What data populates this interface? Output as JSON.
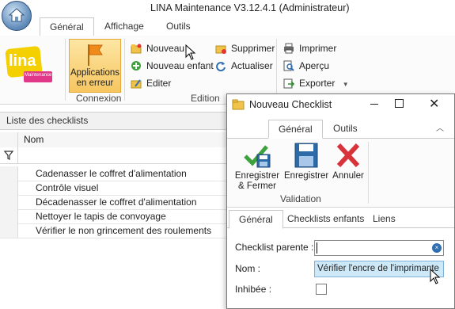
{
  "window": {
    "title": "LINA Maintenance  V3.12.4.1  (Administrateur)"
  },
  "ribbon_tabs": [
    "Général",
    "Affichage",
    "Outils"
  ],
  "logo_text": "lina",
  "logo_subtext": "Maintenance",
  "connexion": {
    "button_label": "Applications en erreur",
    "group_label": "Connexion"
  },
  "edition": {
    "group_label": "Edition",
    "items": {
      "nouveau": "Nouveau",
      "nouveau_enfant": "Nouveau enfant",
      "editer": "Editer",
      "supprimer": "Supprimer",
      "actualiser": "Actualiser"
    }
  },
  "impression": {
    "imprimer": "Imprimer",
    "apercu": "Aperçu",
    "exporter": "Exporter"
  },
  "checklist_panel": {
    "title": "Liste des checklists",
    "column_nom": "Nom",
    "rows": [
      "Cadenasser le coffret d'alimentation",
      "Contrôle visuel",
      "Décadenasser le coffret d'alimentation",
      "Nettoyer le tapis de convoyage",
      "Vérifier le non grincement des roulements"
    ]
  },
  "dialog": {
    "title": "Nouveau Checklist",
    "tabs": [
      "Général",
      "Outils"
    ],
    "buttons": {
      "save_close": "Enregistrer & Fermer",
      "save": "Enregistrer",
      "cancel": "Annuler"
    },
    "group_label": "Validation",
    "content_tabs": [
      "Général",
      "Checklists enfants",
      "Liens"
    ],
    "fields": {
      "parent_label": "Checklist parente :",
      "parent_value": "",
      "nom_label": "Nom :",
      "nom_value": "Vérifier l'encre de l'imprimante",
      "inhibee_label": "Inhibée :",
      "inhibee_checked": false
    }
  },
  "colors": {
    "accent_orange": "#f7c660",
    "selection_blue": "#cde8f6",
    "logo_yellow": "#f4d000",
    "logo_pink": "#e2388a"
  }
}
